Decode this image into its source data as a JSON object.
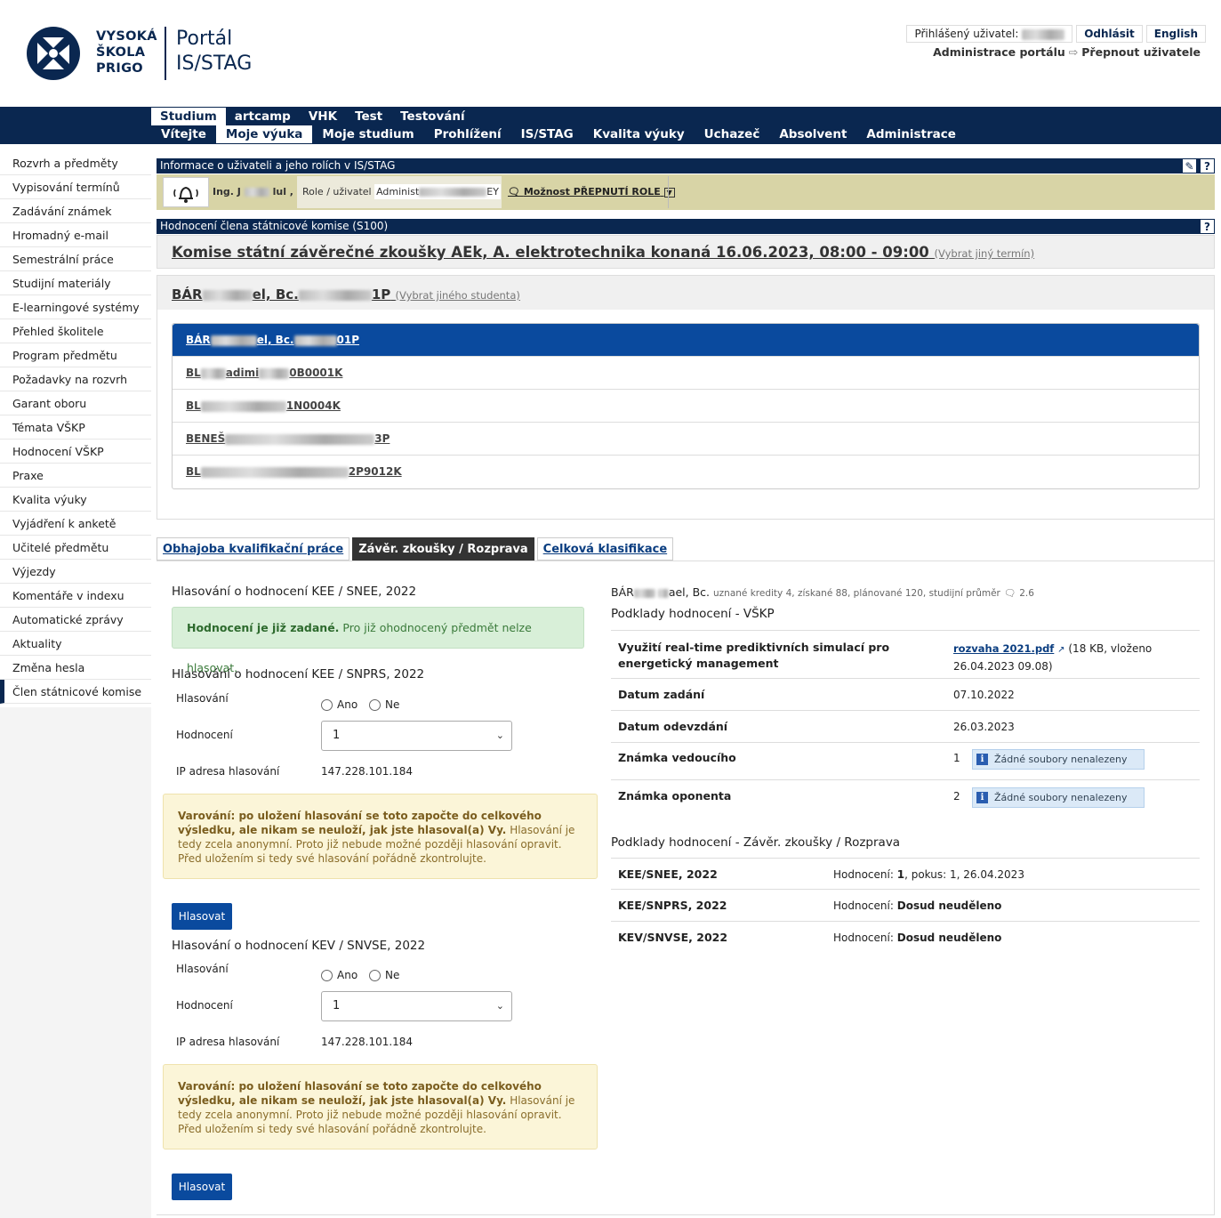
{
  "brand": {
    "logo_line1": "VYSOKÁ",
    "logo_line2": "ŠKOLA",
    "logo_line3": "PRIGO",
    "portal_line1": "Portál",
    "portal_line2": "IS/STAG"
  },
  "header": {
    "logged_user_label": "Přihlášený uživatel:",
    "logout": "Odhlásit",
    "language": "English",
    "admin_portal": "Administrace portálu",
    "switch_user": "Přepnout uživatele"
  },
  "nav": {
    "row1": [
      "Studium",
      "artcamp",
      "VHK",
      "Test",
      "Testování"
    ],
    "row2": [
      "Vítejte",
      "Moje výuka",
      "Moje studium",
      "Prohlížení",
      "IS/STAG",
      "Kvalita výuky",
      "Uchazeč",
      "Absolvent",
      "Administrace"
    ]
  },
  "sidebar": [
    "Rozvrh a předměty",
    "Vypisování termínů",
    "Zadávání známek",
    "Hromadný e-mail",
    "Semestrální práce",
    "Studijní materiály",
    "E-learningové systémy",
    "Přehled školitele",
    "Program předmětu",
    "Požadavky na rozvrh",
    "Garant oboru",
    "Témata VŠKP",
    "Hodnocení VŠKP",
    "Praxe",
    "Kvalita výuky",
    "Vyjádření k anketě",
    "Učitelé předmětu",
    "Výjezdy",
    "Komentáře v indexu",
    "Automatické zprávy",
    "Aktuality",
    "Změna hesla",
    "Člen státnicové komise"
  ],
  "info_bar": {
    "title": "Informace o uživateli a jeho rolích v IS/STAG",
    "edit_icon": "pencil-icon",
    "help_icon": "?",
    "user_prefix": "Ing. J",
    "user_suffix": "lul ,",
    "role_label": "Role / uživatel",
    "role_value_prefix": "Administ",
    "role_value_suffix": "EY",
    "switch_role": "Možnost PŘEPNUTÍ ROLE"
  },
  "eval_bar": {
    "title": "Hodnocení člena státnicové komise (S100)",
    "help_icon": "?"
  },
  "commission": {
    "title": "Komise státní závěrečné zkoušky AEk, A. elektrotechnika konaná 16.06.2023, 08:00 - 09:00",
    "change_link": "(Vybrat jiný termín)"
  },
  "student": {
    "name_prefix": "BÁR",
    "name_mid": "el, Bc.",
    "name_suffix": "1P",
    "change_link": "(Vybrat jiného studenta)",
    "list": [
      {
        "pre": "BÁR",
        "mid": "el, Bc.",
        "post": "01P"
      },
      {
        "pre": "BL",
        "mid": "adimi",
        "post": "0B0001K"
      },
      {
        "pre": "BL",
        "mid": "",
        "post": "1N0004K"
      },
      {
        "pre": "BENEŠ",
        "mid": "",
        "post": "3P"
      },
      {
        "pre": "BL",
        "mid": "",
        "post": "2P9012K"
      }
    ]
  },
  "tabs": [
    "Obhajoba kvalifikační práce",
    "Závěr. zkoušky / Rozprava",
    "Celková klasifikace"
  ],
  "voting": {
    "sec1_title": "Hlasování o hodnocení KEE / SNEE, 2022",
    "sec1_success_bold": "Hodnocení je již zadané.",
    "sec1_success_text": "Pro již ohodnocený předmět nelze hlasovat.",
    "sec2_title": "Hlasování o hodnocení KEE / SNPRS, 2022",
    "sec3_title": "Hlasování o hodnocení KEV / SNVSE, 2022",
    "lbl_vote": "Hlasování",
    "yes": "Ano",
    "no": "Ne",
    "lbl_grade": "Hodnocení",
    "grade_value": "1",
    "lbl_ip": "IP adresa hlasování",
    "ip_value": "147.228.101.184",
    "warn_bold": "Varování: po uložení hlasování se toto započte do celkového výsledku, ale nikam se neuloží, jak jste hlasoval(a) Vy.",
    "warn_text": "Hlasování je tedy zcela anonymní. Proto již nebude možné později hlasování opravit. Před uložením si tedy své hlasování pořádně zkontrolujte.",
    "button": "Hlasovat"
  },
  "right": {
    "student_name_prefix": "BÁR",
    "student_name_suffix": "ael, Bc.",
    "student_stats": "uznané kredity 4, získané 88, plánované 120, studijní průměr",
    "student_avg": "2.6",
    "vskp_title": "Podklady hodnocení - VŠKP",
    "thesis_title": "Využití real-time prediktivních simulací pro energetický management",
    "file_link": "rozvaha 2021.pdf",
    "file_info": "(18 KB, vloženo 26.04.2023 09.08)",
    "assigned_label": "Datum zadání",
    "assigned_value": "07.10.2022",
    "submitted_label": "Datum odevzdání",
    "submitted_value": "26.03.2023",
    "supervisor_label": "Známka vedoucího",
    "supervisor_value": "1",
    "opponent_label": "Známka oponenta",
    "opponent_value": "2",
    "no_files": "Žádné soubory nenalezeny",
    "exam_title": "Podklady hodnocení - Závěr. zkoušky / Rozprava",
    "exam_rows": [
      {
        "subject": "KEE/SNEE, 2022",
        "label": "Hodnocení:",
        "value": "1",
        "extra": ", pokus: 1, 26.04.2023"
      },
      {
        "subject": "KEE/SNPRS, 2022",
        "label": "Hodnocení:",
        "value": "Dosud neuděleno",
        "extra": ""
      },
      {
        "subject": "KEV/SNVSE, 2022",
        "label": "Hodnocení:",
        "value": "Dosud neuděleno",
        "extra": ""
      }
    ]
  }
}
